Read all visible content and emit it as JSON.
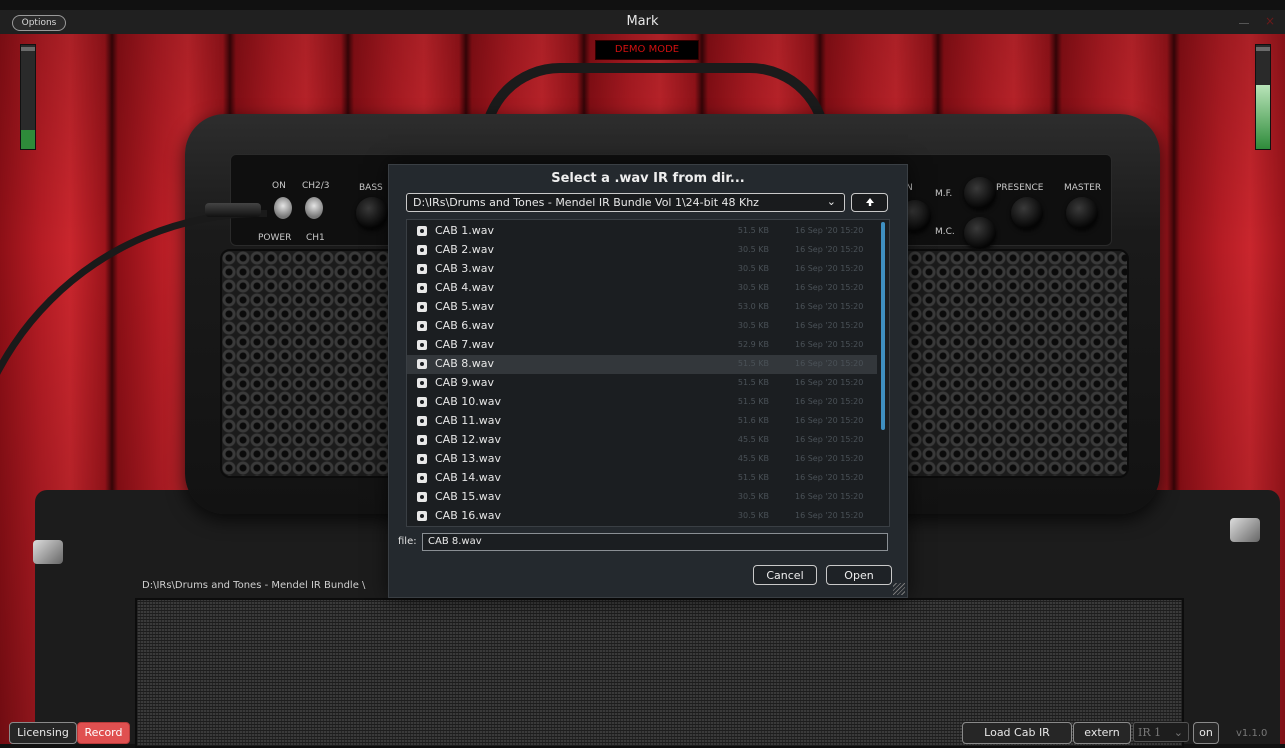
{
  "window": {
    "title": "Mark",
    "options_label": "Options",
    "close_glyph": "×"
  },
  "demo_label": "DEMO MODE",
  "amp": {
    "labels": {
      "on": "ON",
      "ch": "CH2/3",
      "power": "POWER",
      "ch1": "CH1",
      "bass": "BASS",
      "gain_partial": "N",
      "mf": "M.F.",
      "mc": "M.C.",
      "presence": "PRESENCE",
      "master": "MASTER"
    }
  },
  "ir_path": "D:\\IRs\\Drums and Tones - Mendel IR Bundle \\",
  "dialog": {
    "title": "Select a .wav IR from dir...",
    "directory": "D:\\IRs\\Drums and Tones - Mendel IR Bundle Vol 1\\24-bit 48 Khz",
    "directory_chevron": "⌄",
    "up_glyph": "🡅",
    "files": [
      {
        "name": "CAB 1.wav",
        "size": "51.5 KB",
        "date": "16 Sep '20 15:20"
      },
      {
        "name": "CAB 2.wav",
        "size": "30.5 KB",
        "date": "16 Sep '20 15:20"
      },
      {
        "name": "CAB 3.wav",
        "size": "30.5 KB",
        "date": "16 Sep '20 15:20"
      },
      {
        "name": "CAB 4.wav",
        "size": "30.5 KB",
        "date": "16 Sep '20 15:20"
      },
      {
        "name": "CAB 5.wav",
        "size": "53.0 KB",
        "date": "16 Sep '20 15:20"
      },
      {
        "name": "CAB 6.wav",
        "size": "30.5 KB",
        "date": "16 Sep '20 15:20"
      },
      {
        "name": "CAB 7.wav",
        "size": "52.9 KB",
        "date": "16 Sep '20 15:20"
      },
      {
        "name": "CAB 8.wav",
        "size": "51.5 KB",
        "date": "16 Sep '20 15:20",
        "selected": true
      },
      {
        "name": "CAB 9.wav",
        "size": "51.5 KB",
        "date": "16 Sep '20 15:20"
      },
      {
        "name": "CAB 10.wav",
        "size": "51.5 KB",
        "date": "16 Sep '20 15:20"
      },
      {
        "name": "CAB 11.wav",
        "size": "51.6 KB",
        "date": "16 Sep '20 15:20"
      },
      {
        "name": "CAB 12.wav",
        "size": "45.5 KB",
        "date": "16 Sep '20 15:20"
      },
      {
        "name": "CAB 13.wav",
        "size": "45.5 KB",
        "date": "16 Sep '20 15:20"
      },
      {
        "name": "CAB 14.wav",
        "size": "51.5 KB",
        "date": "16 Sep '20 15:20"
      },
      {
        "name": "CAB 15.wav",
        "size": "30.5 KB",
        "date": "16 Sep '20 15:20"
      },
      {
        "name": "CAB 16.wav",
        "size": "30.5 KB",
        "date": "16 Sep '20 15:20"
      }
    ],
    "file_label": "file:",
    "file_value": "CAB 8.wav",
    "cancel_label": "Cancel",
    "open_label": "Open"
  },
  "bottom": {
    "licensing_label": "Licensing",
    "record_label": "Record",
    "load_cab_label": "Load Cab IR",
    "extern_label": "extern",
    "ir_value": "IR 1",
    "ir_chevron": "⌄",
    "on_label": "on",
    "version": "v1.1.0"
  },
  "meters": {
    "left_level": 0.18,
    "right_level": 0.62
  },
  "colors": {
    "accent_scroll": "#3f8fc0",
    "record": "#e05050",
    "demo_text": "#d01010",
    "meter_green": "#2e8b3a"
  }
}
